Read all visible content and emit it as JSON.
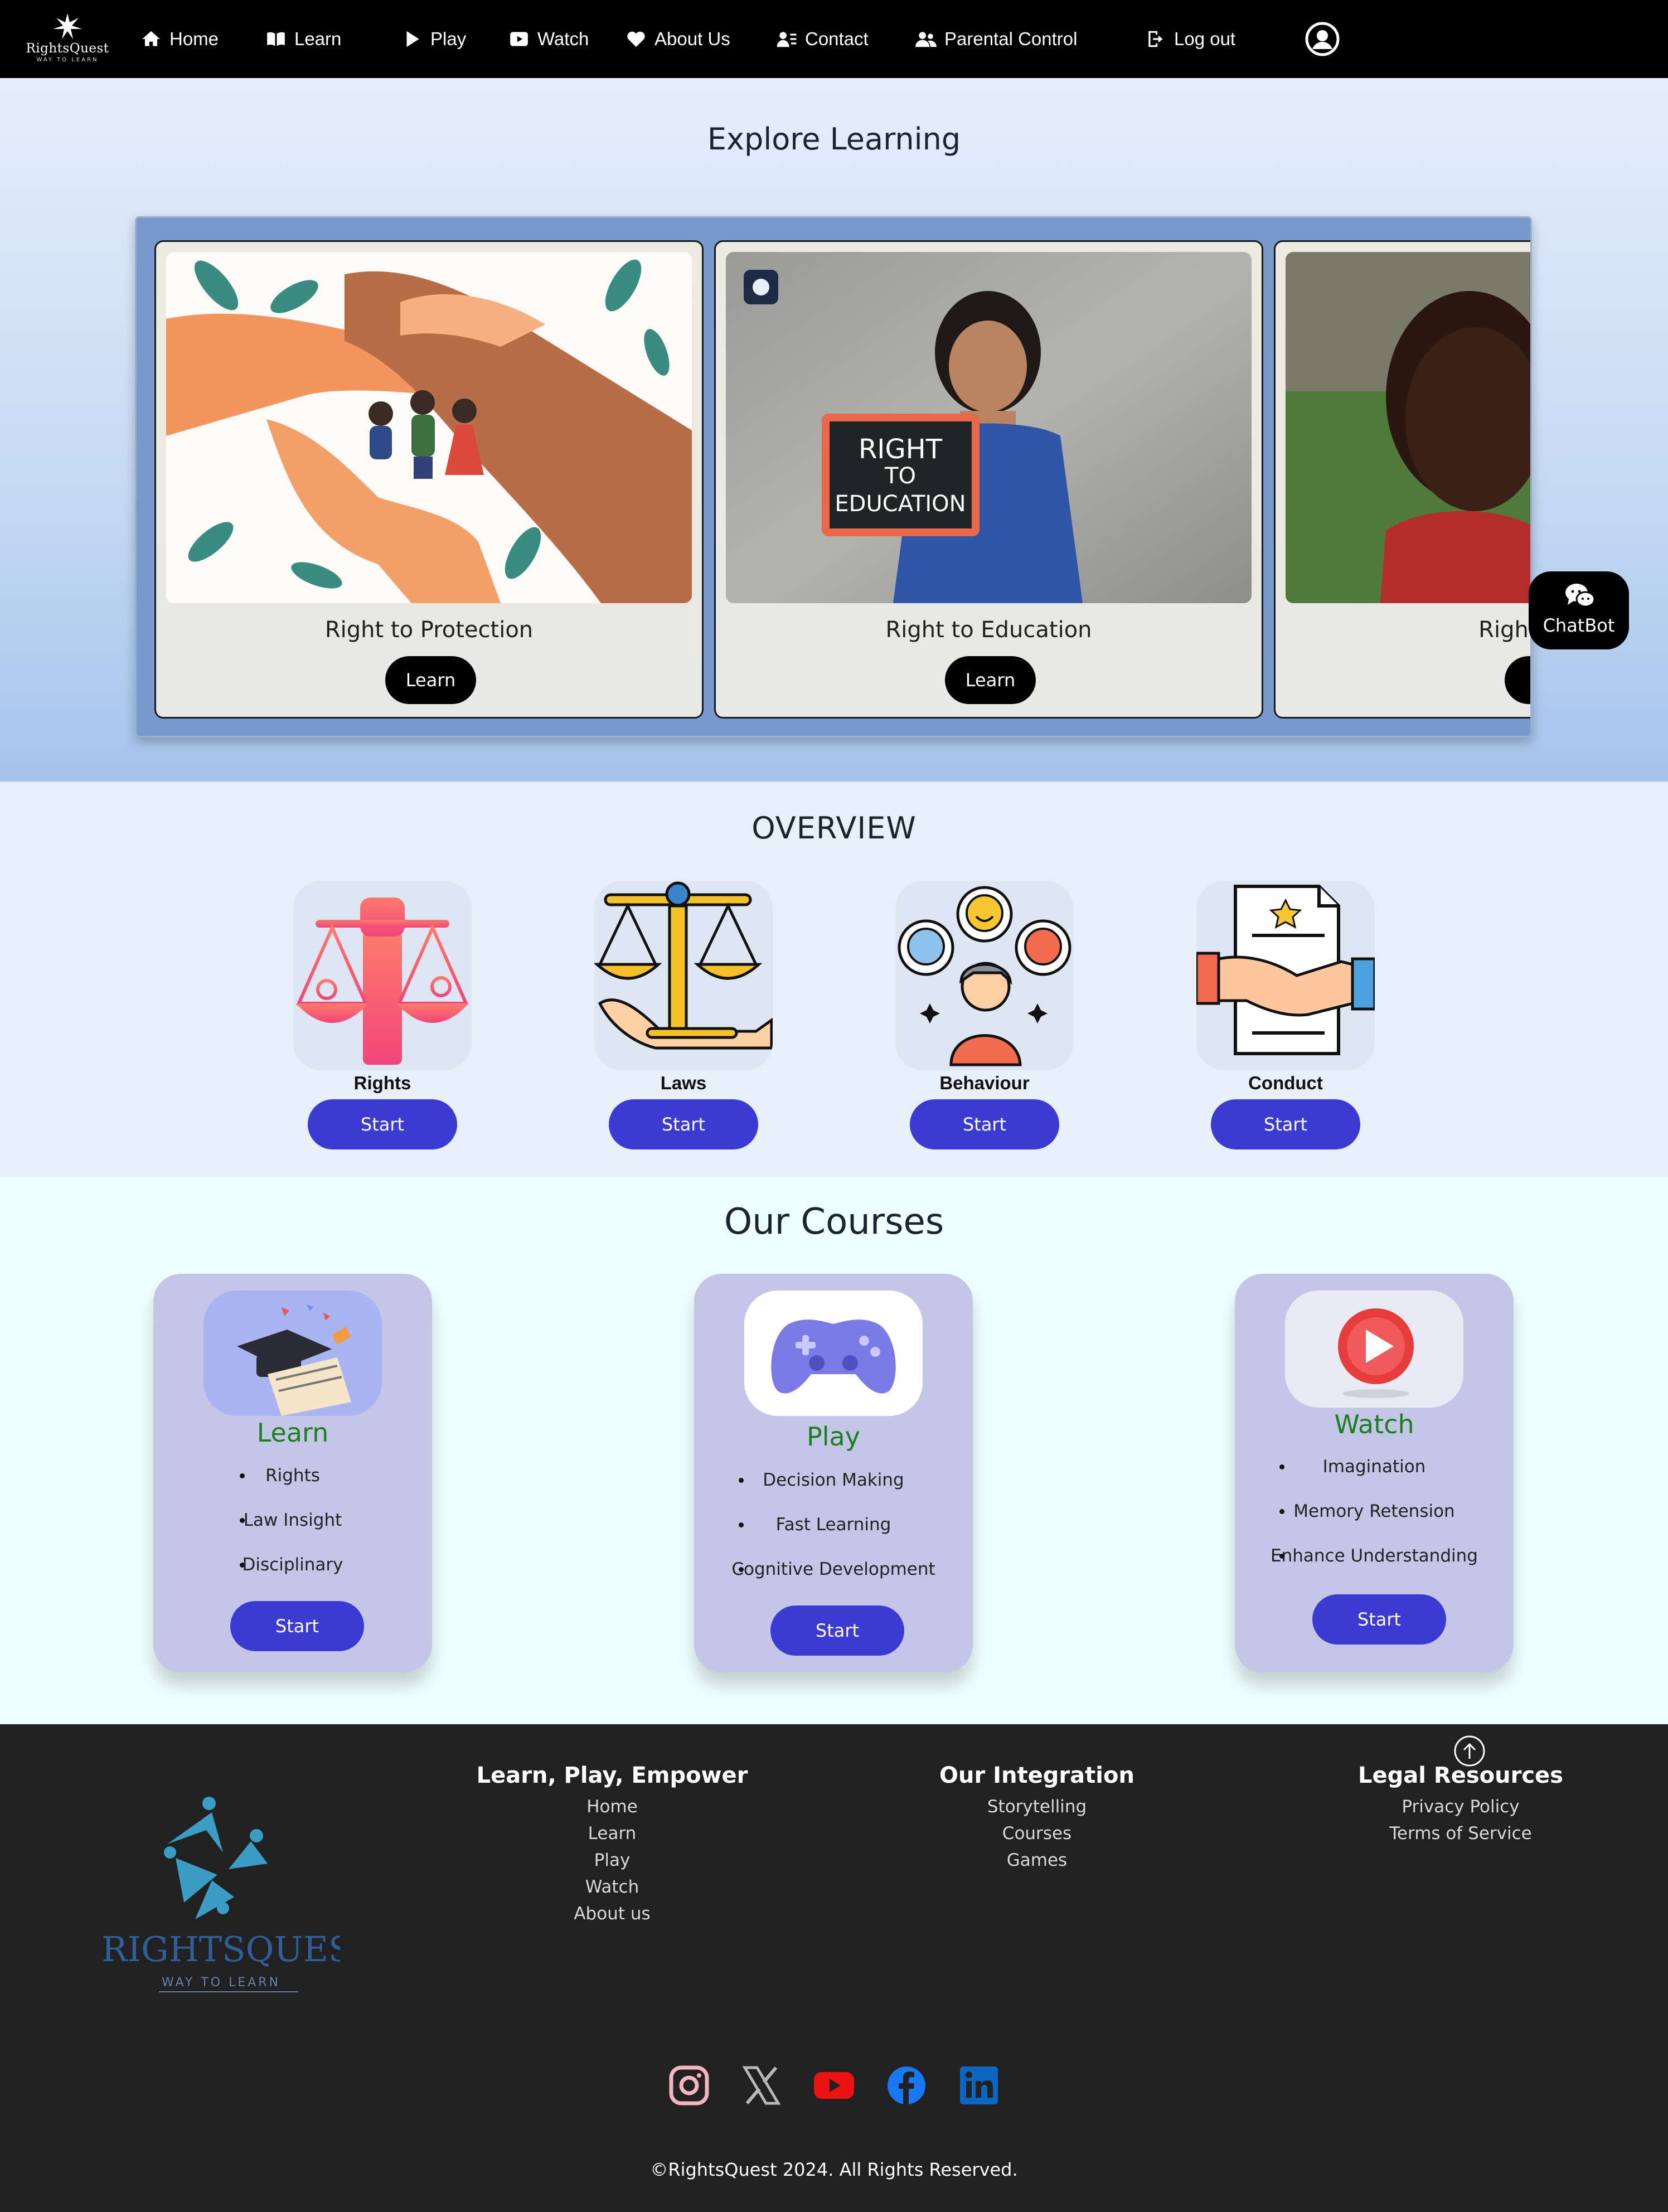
{
  "nav": {
    "logo_word": "RightsQuest",
    "logo_tag": "WAY TO LEARN",
    "items": [
      {
        "label": "Home",
        "icon": "home-icon"
      },
      {
        "label": "Learn",
        "icon": "book-icon"
      },
      {
        "label": "Play",
        "icon": "play-icon"
      },
      {
        "label": "Watch",
        "icon": "video-icon"
      },
      {
        "label": "About Us",
        "icon": "heart-icon"
      },
      {
        "label": "Contact",
        "icon": "contact-icon"
      },
      {
        "label": "Parental Control",
        "icon": "users-icon"
      },
      {
        "label": "Log out",
        "icon": "logout-icon"
      }
    ],
    "profile_icon": "user-circle-icon"
  },
  "hero": {
    "title": "Explore Learning",
    "cards": [
      {
        "title": "Right to Protection",
        "button": "Learn"
      },
      {
        "title": "Right to Education",
        "button": "Learn",
        "sign_lines": [
          "RIGHT",
          "TO",
          "EDUCATION"
        ]
      },
      {
        "title": "Right to Non",
        "button": "L"
      }
    ]
  },
  "chatbot": {
    "label": "ChatBot",
    "icon": "chat-bubbles-icon"
  },
  "overview": {
    "title": "OVERVIEW",
    "items": [
      {
        "label": "Rights",
        "button": "Start",
        "icon": "raised-fist-scales-icon"
      },
      {
        "label": "Laws",
        "button": "Start",
        "icon": "justice-scales-hand-icon"
      },
      {
        "label": "Behaviour",
        "button": "Start",
        "icon": "emotions-person-icon"
      },
      {
        "label": "Conduct",
        "button": "Start",
        "icon": "handshake-contract-icon"
      }
    ]
  },
  "courses": {
    "title": "Our Courses",
    "items": [
      {
        "name": "Learn",
        "points": [
          "Rights",
          "Law Insight",
          "Disciplinary"
        ],
        "button": "Start",
        "icon": "graduation-books-icon"
      },
      {
        "name": "Play",
        "points": [
          "Decision Making",
          "Fast Learning",
          "Cognitive Development"
        ],
        "button": "Start",
        "icon": "gamepad-icon"
      },
      {
        "name": "Watch",
        "points": [
          "Imagination",
          "Memory Retension",
          "Enhance Understanding"
        ],
        "button": "Start",
        "icon": "play-button-icon"
      }
    ]
  },
  "footer": {
    "logo_word": "RIGHTSQUEST",
    "logo_tag": "WAY TO LEARN",
    "columns": [
      {
        "heading": "Learn, Play, Empower",
        "links": [
          "Home",
          "Learn",
          "Play",
          "Watch",
          "About us"
        ]
      },
      {
        "heading": "Our Integration",
        "links": [
          "Storytelling",
          "Courses",
          "Games"
        ]
      },
      {
        "heading": "Legal Resources",
        "links": [
          "Privacy Policy",
          "Terms of Service"
        ]
      }
    ],
    "social": [
      "instagram-icon",
      "x-icon",
      "youtube-icon",
      "facebook-icon",
      "linkedin-icon"
    ],
    "copyright": "©RightsQuest 2024. All Rights Reserved."
  },
  "colors": {
    "nav_bg": "#000000",
    "primary_button": "#3b3bd4",
    "course_card": "#c4c6e7",
    "course_name": "#1b7f1b",
    "footer_bg": "#212121"
  }
}
